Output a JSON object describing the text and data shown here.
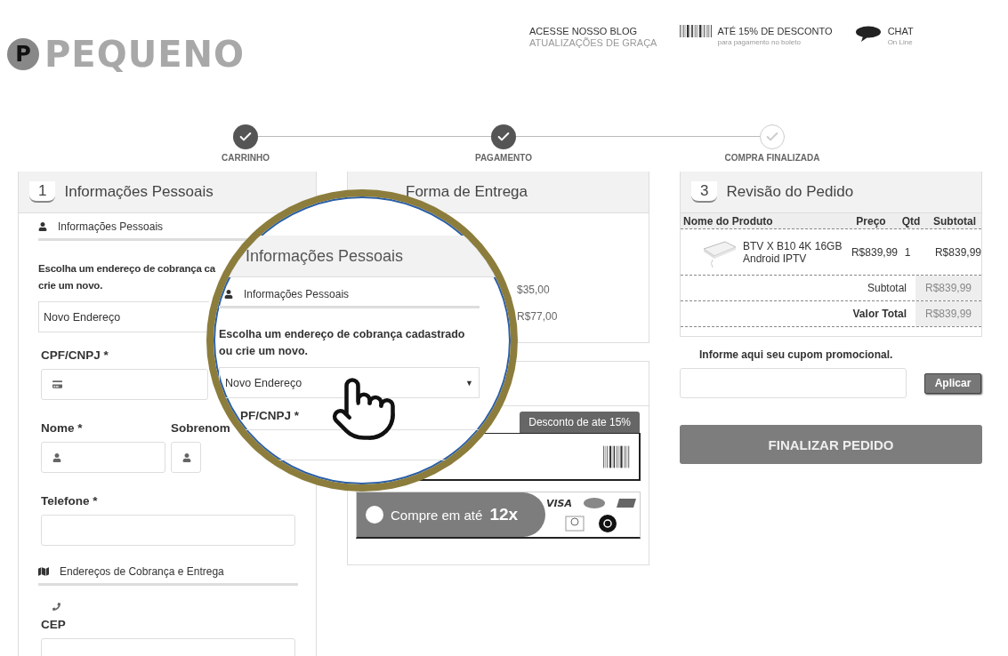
{
  "header": {
    "logo_mark": "P",
    "logo": "PEQUENO",
    "blog": {
      "title": "ACESSE NOSSO BLOG",
      "subtitle": "ATUALIZAÇÕES DE GRAÇA"
    },
    "promo": {
      "title": "ATÉ 15% DE DESCONTO",
      "subtitle": "para pagamento no boleto"
    },
    "chat": {
      "title": "CHAT",
      "subtitle": "On Line"
    }
  },
  "steps": [
    {
      "label": "CARRINHO",
      "done": true
    },
    {
      "label": "PAGAMENTO",
      "done": true
    },
    {
      "label": "COMPRA FINALIZADA",
      "done": false
    }
  ],
  "personal": {
    "number": "1",
    "title": "Informações Pessoais",
    "section": "Informações Pessoais",
    "prompt": [
      "Escolha um endereço de cobrança ca",
      "crie um novo."
    ],
    "address_select": {
      "value": "Novo Endereço"
    },
    "cpf_label": "CPF/CNPJ *",
    "name_fields": [
      {
        "label": "Nome *"
      },
      {
        "label": "Sobrenom"
      }
    ],
    "phone_label": "Telefone *",
    "address_section": "Endereços de Cobrança e Entrega",
    "cep_label": "CEP"
  },
  "shipping": {
    "title": "Forma de Entrega",
    "options": [
      {
        "price": "$35,00"
      },
      {
        "price": "R$77,00"
      }
    ]
  },
  "payment": {
    "discount_tag": "Desconto de ate 15%",
    "installment": {
      "label": "Compre em até",
      "count": "12x",
      "selected": false
    },
    "card_brand": "VISA"
  },
  "review": {
    "number": "3",
    "title": "Revisão do Pedido",
    "columns": [
      "Nome do Produto",
      "Preço",
      "Qtd",
      "Subtotal"
    ],
    "rows": [
      {
        "product": [
          "BTV X B10 4K 16GB",
          "Android IPTV"
        ],
        "price": "R$839,99",
        "qty": "1",
        "subtotal": "R$839,99"
      }
    ],
    "totals": [
      {
        "label": "Subtotal",
        "value": "R$839,99",
        "bold": false
      },
      {
        "label": "Valor Total",
        "value": "R$839,99",
        "bold": true
      }
    ],
    "coupon_label": "Informe aqui seu cupom promocional.",
    "apply_button": "Aplicar",
    "finish_button": "FINALIZAR PEDIDO"
  },
  "magnifier": {
    "title": "Informações Pessoais",
    "section": "Informações Pessoais",
    "prompt": "Escolha um endereço de cobrança cadastrado ou crie um novo.",
    "select": {
      "value": "Novo Endereço",
      "caret": "▼"
    },
    "field_label": "PF/CNPJ *"
  }
}
